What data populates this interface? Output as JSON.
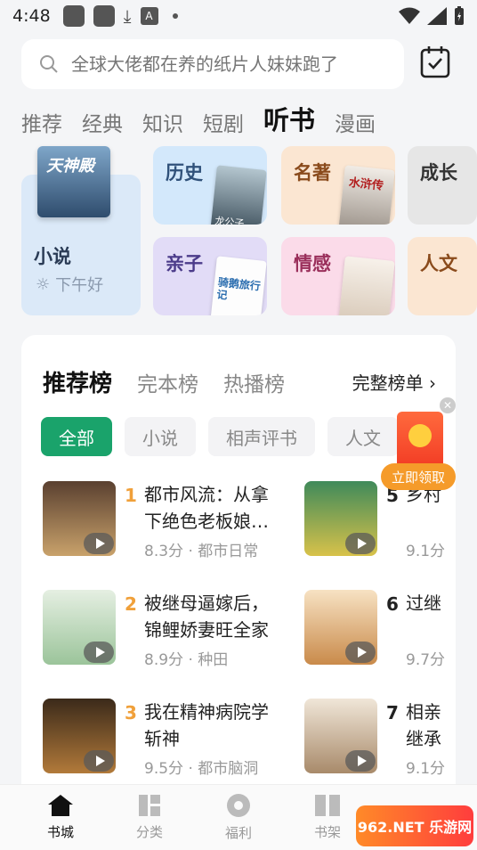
{
  "status": {
    "time": "4:48"
  },
  "search": {
    "placeholder": "全球大佬都在养的纸片人妹妹跑了"
  },
  "tabs": [
    {
      "label": "推荐"
    },
    {
      "label": "经典"
    },
    {
      "label": "知识"
    },
    {
      "label": "短剧"
    },
    {
      "label": "听书",
      "active": true
    },
    {
      "label": "漫画"
    }
  ],
  "featured": {
    "label": "小说",
    "greeting": "下午好",
    "cover_text": "天神殿"
  },
  "categories": [
    {
      "label": "历史",
      "cover_text": "龙公子"
    },
    {
      "label": "名著",
      "cover_text": "水浒传"
    },
    {
      "label": "成长"
    },
    {
      "label": "亲子",
      "cover_text": "骑鹅旅行记"
    },
    {
      "label": "情感"
    },
    {
      "label": "人文"
    }
  ],
  "ranks": {
    "tabs": [
      "推荐榜",
      "完本榜",
      "热播榜"
    ],
    "full_label": "完整榜单 ›"
  },
  "chips": [
    "全部",
    "小说",
    "相声评书",
    "人文"
  ],
  "books": [
    {
      "rank": "1",
      "title": "都市风流：从拿下绝色老板娘…",
      "meta": "8.3分 · 都市日常"
    },
    {
      "rank": "2",
      "title": "被继母逼嫁后，锦鲤娇妻旺全家",
      "meta": "8.9分 · 种田"
    },
    {
      "rank": "3",
      "title": "我在精神病院学斩神",
      "meta": "9.5分 · 都市脑洞"
    },
    {
      "rank": "5",
      "title": "乡村",
      "meta": "9.1分"
    },
    {
      "rank": "6",
      "title": "过继",
      "meta": "9.7分"
    },
    {
      "rank": "7",
      "title": "相亲继承",
      "meta": "9.1分"
    }
  ],
  "promo": {
    "button": "立即领取"
  },
  "nav": [
    {
      "label": "书城",
      "icon": "home-icon",
      "active": true
    },
    {
      "label": "分类",
      "icon": "grid-icon"
    },
    {
      "label": "福利",
      "icon": "gift-icon"
    },
    {
      "label": "书架",
      "icon": "bookshelf-icon"
    }
  ],
  "watermark": {
    "text": "962.NET 乐游网"
  },
  "colors": {
    "accent": "#1aa36b",
    "rank_color": "#f0a03a",
    "promo": "#f23b24"
  }
}
